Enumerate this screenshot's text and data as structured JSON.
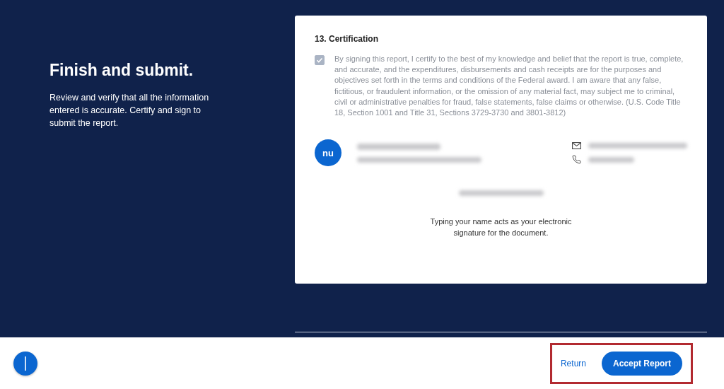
{
  "intro": {
    "title": "Finish and submit.",
    "text": "Review and verify that all the information entered is accurate. Certify and sign to submit the report."
  },
  "certification": {
    "heading": "13. Certification",
    "checked": true,
    "disabled": true,
    "statement": "By signing this report, I certify to the best of my knowledge and belief that the report is true, complete, and accurate, and the expenditures, disbursements and cash receipts are for the purposes and objectives set forth in the terms and conditions of the Federal award. I am aware that any false, fictitious, or fraudulent information, or the omission of any material fact, may subject me to criminal, civil or administrative penalties for fraud, false statements, false claims or otherwise. (U.S. Code Title 18, Section 1001 and Title 31, Sections 3729-3730 and 3801-3812)"
  },
  "signer": {
    "initials": "nu",
    "redacted": true
  },
  "signature_note": "Typing your name acts as your electronic signature for the document.",
  "footer": {
    "return": "Return",
    "accept": "Accept Report",
    "highlighted": true
  }
}
